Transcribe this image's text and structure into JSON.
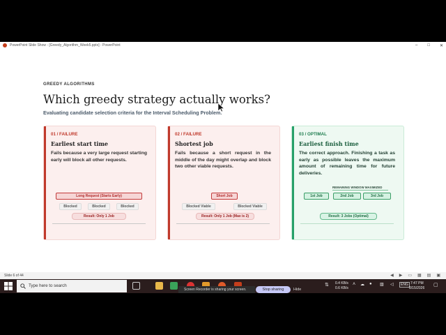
{
  "window": {
    "title": "PowerPoint Slide Show - [Greedy_Algorithm_Week5.pptx] - PowerPoint",
    "controls": [
      "–",
      "□",
      "✕"
    ]
  },
  "slide": {
    "eyebrow": "GREEDY ALGORITHMS",
    "title": "Which greedy strategy actually works?",
    "subtitle": "Evaluating candidate selection criteria for the Interval Scheduling Problem.",
    "cards": [
      {
        "tag": "01 / FAILURE",
        "heading": "Earliest start time",
        "body": "Fails because a very large request starting early will block all other requests.",
        "main_job": "Long Request (Starts Early)",
        "blocked": [
          "Blocked",
          "Blocked",
          "Blocked"
        ],
        "result": "Result: Only 1 Job"
      },
      {
        "tag": "02 / FAILURE",
        "heading": "Shortest job",
        "body": "Fails because a short request in the middle of the day might overlap and block two other viable requests.",
        "main_job": "Short Job",
        "blocked": [
          "Blocked Viable",
          "Blocked Viable"
        ],
        "result": "Result: Only 1 Job (Max is 2)"
      },
      {
        "tag": "03 / OPTIMAL",
        "heading": "Earliest finish time",
        "body": "The correct approach. Finishing a task as early as possible leaves the maximum amount of remaining time for future deliveries.",
        "window_label": "REMAINING WINDOW MAXIMIZED",
        "jobs": [
          "1st Job",
          "2nd Job",
          "3rd Job"
        ],
        "result": "Result: 3 Jobs (Optimal)"
      }
    ]
  },
  "statusbar": {
    "slide_indicator": "Slide 6 of 44"
  },
  "taskbar": {
    "search_placeholder": "Type here to search",
    "recorder_text": "Screen Recorder is sharing your screen.",
    "stop_sharing": "Stop sharing",
    "hide": "Hide",
    "net_up": "0.4 KB/s",
    "net_down": "0.6 KB/s",
    "time": "7:47 PM",
    "date": "8/15/2026"
  },
  "colors": {
    "failure_accent": "#c0392b",
    "failure_bg": "#fcefee",
    "optimal_accent": "#27a06a",
    "optimal_bg": "#eef9f2"
  }
}
